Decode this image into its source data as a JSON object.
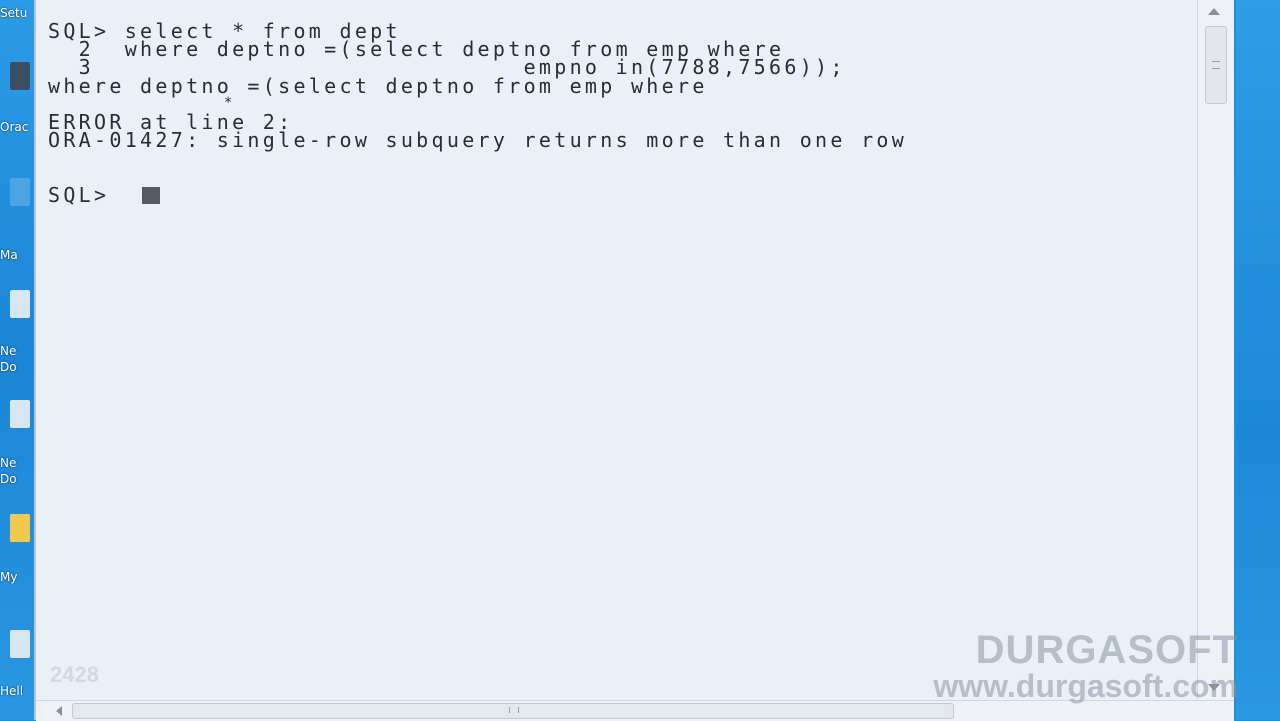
{
  "desktop": {
    "labels": [
      "Setu",
      "Orac",
      "Ma",
      "Ne",
      "Do",
      "Ne",
      "Do",
      "My",
      "Hell"
    ]
  },
  "console": {
    "lines": [
      "SQL> select * from dept",
      "  2  where deptno =(select deptno from emp where",
      "  3                            empno in(7788,7566));",
      "where deptno =(select deptno from emp where",
      "               *",
      "ERROR at line 2:",
      "ORA-01427: single-row subquery returns more than one row",
      "SQL>"
    ]
  },
  "watermark": {
    "brand": "DURGASOFT",
    "url": "www.durgasoft.com",
    "counter": "2428"
  },
  "colors": {
    "console_bg": "#e9f0f7",
    "console_text": "#2a2e34",
    "desktop": "#1f8fd8"
  }
}
